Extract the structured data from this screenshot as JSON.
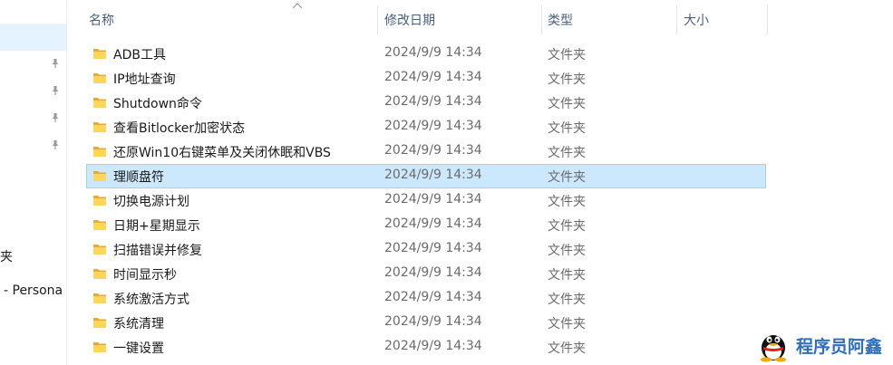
{
  "nav": {
    "partial_item_1": "夹",
    "partial_item_2": "- Persona"
  },
  "columns": {
    "name": "名称",
    "modified": "修改日期",
    "type": "类型",
    "size": "大小"
  },
  "rows": [
    {
      "name": "ADB工具",
      "modified": "2024/9/9 14:34",
      "type": "文件夹"
    },
    {
      "name": "IP地址查询",
      "modified": "2024/9/9 14:34",
      "type": "文件夹"
    },
    {
      "name": "Shutdown命令",
      "modified": "2024/9/9 14:34",
      "type": "文件夹"
    },
    {
      "name": "查看Bitlocker加密状态",
      "modified": "2024/9/9 14:34",
      "type": "文件夹"
    },
    {
      "name": "还原Win10右键菜单及关闭休眠和VBS",
      "modified": "2024/9/9 14:34",
      "type": "文件夹"
    },
    {
      "name": "理顺盘符",
      "modified": "2024/9/9 14:34",
      "type": "文件夹"
    },
    {
      "name": "切换电源计划",
      "modified": "2024/9/9 14:34",
      "type": "文件夹"
    },
    {
      "name": "日期+星期显示",
      "modified": "2024/9/9 14:34",
      "type": "文件夹"
    },
    {
      "name": "扫描错误并修复",
      "modified": "2024/9/9 14:34",
      "type": "文件夹"
    },
    {
      "name": "时间显示秒",
      "modified": "2024/9/9 14:34",
      "type": "文件夹"
    },
    {
      "name": "系统激活方式",
      "modified": "2024/9/9 14:34",
      "type": "文件夹"
    },
    {
      "name": "系统清理",
      "modified": "2024/9/9 14:34",
      "type": "文件夹"
    },
    {
      "name": "一键设置",
      "modified": "2024/9/9 14:34",
      "type": "文件夹"
    }
  ],
  "selected_row": 5,
  "watermark": {
    "text": "程序员阿鑫",
    "icon": "penguin-icon"
  },
  "colors": {
    "selected_bg": "#cce8ff",
    "selected_border": "#99d1ff",
    "folder": "#f5c242",
    "header_text": "#4c607a"
  }
}
